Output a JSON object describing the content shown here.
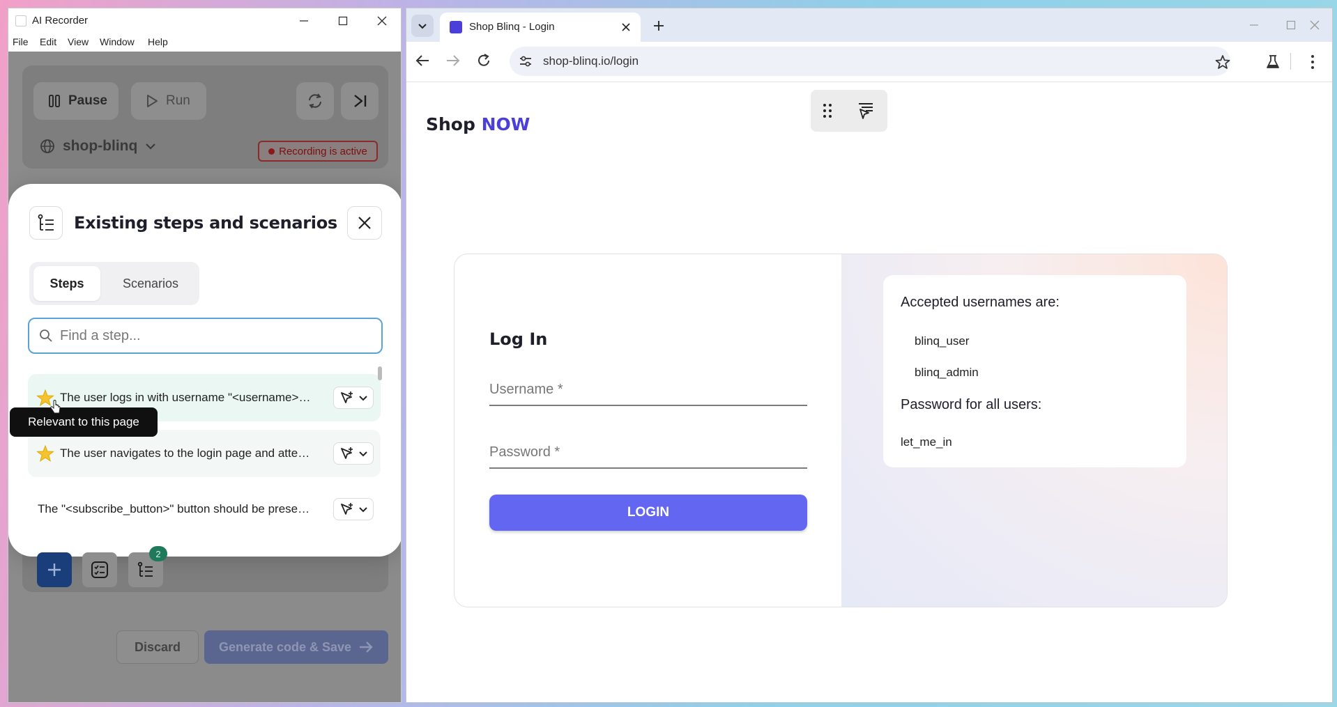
{
  "recorder": {
    "title": "AI Recorder",
    "menu": [
      "File",
      "Edit",
      "View",
      "Window",
      "Help"
    ],
    "pause_label": "Pause",
    "run_label": "Run",
    "project": "shop-blinq",
    "recording_status": "Recording is active",
    "modal": {
      "title": "Existing steps and scenarios",
      "tabs": [
        "Steps",
        "Scenarios"
      ],
      "search_placeholder": "Find a step...",
      "steps": [
        {
          "text": "The user logs in with username \"<username> \" and password \"<password>\"",
          "starred": true
        },
        {
          "text": "The user navigates to the login page and attempts to log in",
          "starred": true
        },
        {
          "text": "The \"<subscribe_button>\" button should be present on the page",
          "starred": false
        }
      ],
      "tooltip": "Relevant to this page"
    },
    "step_count": "2",
    "discard_label": "Discard",
    "generate_label": "Generate code & Save"
  },
  "browser": {
    "tab_title": "Shop Blinq - Login",
    "url": "shop-blinq.io/login",
    "page": {
      "brand_shop": "Shop",
      "brand_now": "NOW",
      "login_heading": "Log In",
      "username_placeholder": "Username *",
      "password_placeholder": "Password *",
      "login_button": "LOGIN",
      "accepted_title": "Accepted usernames are:",
      "usernames": [
        "blinq_user",
        "blinq_admin"
      ],
      "password_title": "Password for all users:",
      "password_value": "let_me_in"
    }
  },
  "colors": {
    "accent": "#6366f1",
    "brand_now": "#4a3fd8",
    "search_border": "#5aa3d8",
    "row_highlight": "#eaf7f3"
  }
}
